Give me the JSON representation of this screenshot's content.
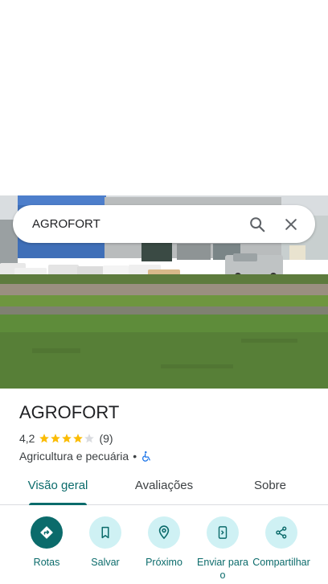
{
  "search": {
    "query": "AGROFORT"
  },
  "place": {
    "name": "AGROFORT",
    "rating": "4,2",
    "stars": 4.2,
    "review_count": "(9)",
    "category": "Agricultura e pecuária",
    "separator": "•"
  },
  "tabs": [
    {
      "label": "Visão geral",
      "active": true
    },
    {
      "label": "Avaliações",
      "active": false
    },
    {
      "label": "Sobre",
      "active": false
    }
  ],
  "actions": [
    {
      "label": "Rotas",
      "icon": "directions-icon"
    },
    {
      "label": "Salvar",
      "icon": "bookmark-icon"
    },
    {
      "label": "Próximo",
      "icon": "nearby-icon"
    },
    {
      "label": "Enviar para o",
      "icon": "send-to-phone-icon"
    },
    {
      "label": "Compartilhar",
      "icon": "share-icon"
    }
  ],
  "colors": {
    "accent": "#0b6b6b",
    "action_bg": "#cff1f4",
    "star": "#fbbc04",
    "accessibility": "#1a73e8"
  }
}
